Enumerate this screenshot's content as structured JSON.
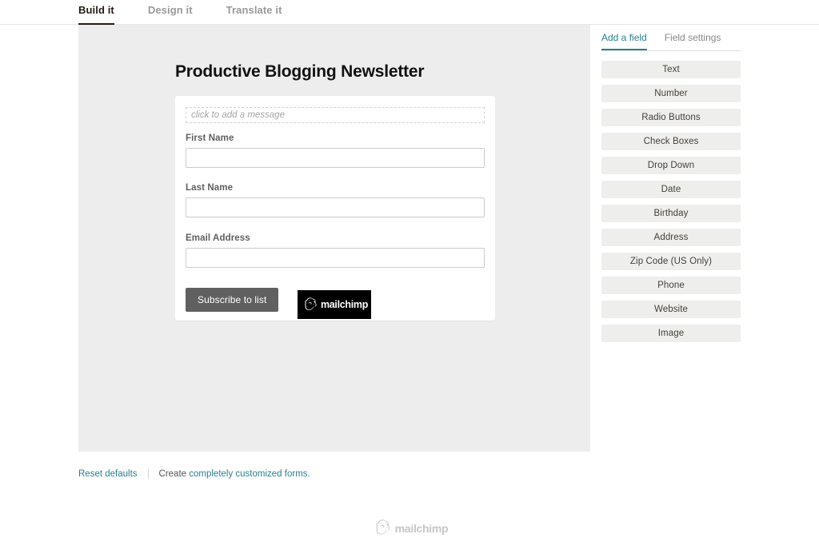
{
  "topbar": {
    "tabs": [
      {
        "label": "Build it",
        "active": true
      },
      {
        "label": "Design it",
        "active": false
      },
      {
        "label": "Translate it",
        "active": false
      }
    ]
  },
  "form": {
    "title": "Productive Blogging Newsletter",
    "message_placeholder": "click to add a message",
    "fields": [
      {
        "label": "First Name",
        "value": ""
      },
      {
        "label": "Last Name",
        "value": ""
      },
      {
        "label": "Email Address",
        "value": ""
      }
    ],
    "submit_label": "Subscribe to list",
    "badge": {
      "wordmark": "mailchimp",
      "icon": "mailchimp-freddie-icon"
    }
  },
  "sidebar": {
    "tabs": [
      {
        "label": "Add a field",
        "active": true
      },
      {
        "label": "Field settings",
        "active": false
      }
    ],
    "field_buttons": [
      "Text",
      "Number",
      "Radio Buttons",
      "Check Boxes",
      "Drop Down",
      "Date",
      "Birthday",
      "Address",
      "Zip Code (US Only)",
      "Phone",
      "Website",
      "Image"
    ]
  },
  "footer": {
    "reset_label": "Reset defaults",
    "create_prefix": "Create",
    "create_link": "completely customized forms",
    "create_suffix": ".",
    "logo_wordmark": "mailchimp"
  },
  "colors": {
    "accent_teal": "#2b7f8c",
    "canvas_gray": "#ededed",
    "button_gray": "#606060",
    "field_button_gray": "#eeeeec",
    "active_tab_dark": "#241c15"
  }
}
